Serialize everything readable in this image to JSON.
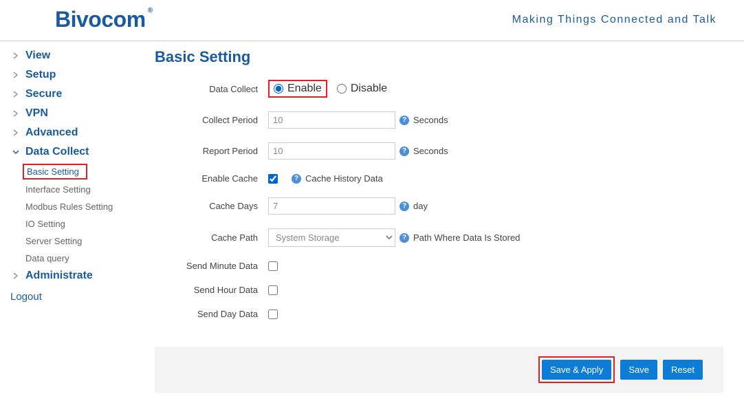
{
  "header": {
    "logo": "Bivocom",
    "tagline": "Making Things Connected and Talk"
  },
  "sidebar": {
    "items": [
      {
        "label": "View",
        "expanded": false
      },
      {
        "label": "Setup",
        "expanded": false
      },
      {
        "label": "Secure",
        "expanded": false
      },
      {
        "label": "VPN",
        "expanded": false
      },
      {
        "label": "Advanced",
        "expanded": false
      },
      {
        "label": "Data Collect",
        "expanded": true,
        "children": [
          {
            "label": "Basic Setting",
            "active": true
          },
          {
            "label": "Interface Setting"
          },
          {
            "label": "Modbus Rules Setting"
          },
          {
            "label": "IO Setting"
          },
          {
            "label": "Server Setting"
          },
          {
            "label": "Data query"
          }
        ]
      },
      {
        "label": "Administrate",
        "expanded": false
      }
    ],
    "logout": "Logout"
  },
  "page": {
    "title": "Basic Setting",
    "fields": {
      "data_collect": {
        "label": "Data Collect",
        "enable": "Enable",
        "disable": "Disable",
        "value": "enable"
      },
      "collect_period": {
        "label": "Collect Period",
        "value": "10",
        "unit": "Seconds"
      },
      "report_period": {
        "label": "Report Period",
        "value": "10",
        "unit": "Seconds"
      },
      "enable_cache": {
        "label": "Enable Cache",
        "checked": true,
        "hint": "Cache History Data"
      },
      "cache_days": {
        "label": "Cache Days",
        "value": "7",
        "unit": "day"
      },
      "cache_path": {
        "label": "Cache Path",
        "value": "System Storage",
        "hint": "Path Where Data Is Stored"
      },
      "send_minute": {
        "label": "Send Minute Data",
        "checked": false
      },
      "send_hour": {
        "label": "Send Hour Data",
        "checked": false
      },
      "send_day": {
        "label": "Send Day Data",
        "checked": false
      }
    },
    "buttons": {
      "save_apply": "Save & Apply",
      "save": "Save",
      "reset": "Reset"
    }
  }
}
